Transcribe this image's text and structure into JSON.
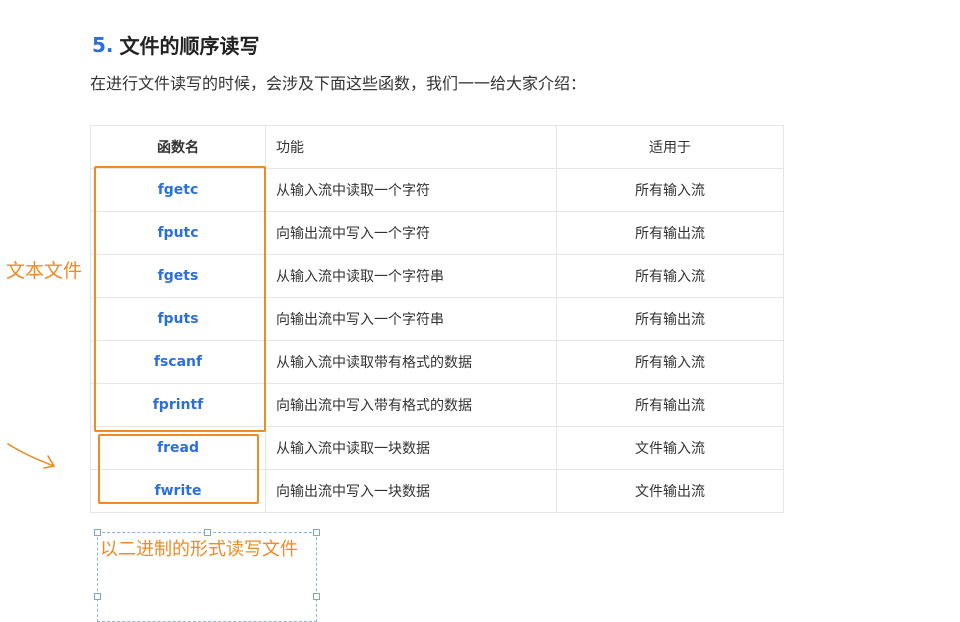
{
  "heading": {
    "number": "5.",
    "title": "文件的顺序读写"
  },
  "intro": "在进行文件读写的时候，会涉及下面这些函数，我们一一给大家介绍：",
  "table": {
    "headers": [
      "函数名",
      "功能",
      "适用于"
    ],
    "rows": [
      {
        "name": "fgetc",
        "desc": "从输入流中读取一个字符",
        "scope": "所有输入流"
      },
      {
        "name": "fputc",
        "desc": "向输出流中写入一个字符",
        "scope": "所有输出流"
      },
      {
        "name": "fgets",
        "desc": "从输入流中读取一个字符串",
        "scope": "所有输入流"
      },
      {
        "name": "fputs",
        "desc": "向输出流中写入一个字符串",
        "scope": "所有输出流"
      },
      {
        "name": "fscanf",
        "desc": "从输入流中读取带有格式的数据",
        "scope": "所有输入流"
      },
      {
        "name": "fprintf",
        "desc": "向输出流中写入带有格式的数据",
        "scope": "所有输出流"
      },
      {
        "name": "fread",
        "desc": "从输入流中读取一块数据",
        "scope": "文件输入流"
      },
      {
        "name": "fwrite",
        "desc": "向输出流中写入一块数据",
        "scope": "文件输出流"
      }
    ]
  },
  "annotations": {
    "text_file_label": "文本文件",
    "binary_note": "以二进制的形式读写文件",
    "color": "#f08a24"
  }
}
